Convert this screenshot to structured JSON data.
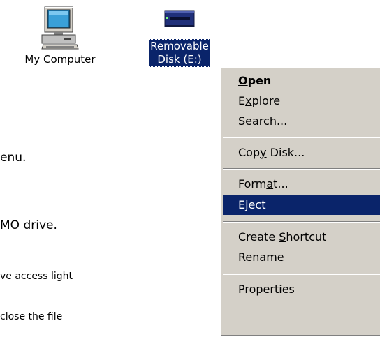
{
  "desktop": {
    "icons": [
      {
        "label": "My Computer"
      },
      {
        "label_line1": "Removable",
        "label_line2": "Disk (E:)"
      }
    ]
  },
  "document": {
    "lines": [
      "enu.",
      "MO drive.",
      "ve access light",
      "close the file"
    ]
  },
  "context_menu": {
    "items": [
      {
        "pre": "",
        "acc": "O",
        "post": "pen",
        "bold": true
      },
      {
        "pre": "E",
        "acc": "x",
        "post": "plore"
      },
      {
        "pre": "S",
        "acc": "e",
        "post": "arch..."
      },
      {
        "pre": "Cop",
        "acc": "y",
        "post": " Disk..."
      },
      {
        "pre": "Form",
        "acc": "a",
        "post": "t..."
      },
      {
        "pre": "Eject",
        "acc": "",
        "post": "",
        "highlighted": true
      },
      {
        "pre": "Create ",
        "acc": "S",
        "post": "hortcut"
      },
      {
        "pre": "Rena",
        "acc": "m",
        "post": "e"
      },
      {
        "pre": "P",
        "acc": "r",
        "post": "operties"
      }
    ]
  },
  "colors": {
    "selection": "#0a246a",
    "menu_face": "#d4d0c8"
  }
}
